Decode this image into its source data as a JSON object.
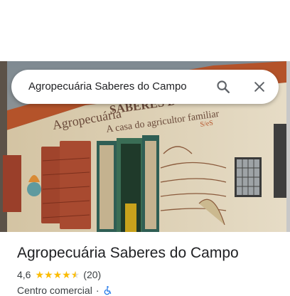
{
  "search": {
    "query": "Agropecuária Saberes do Campo"
  },
  "photo": {
    "sign_main": "Agropecuária",
    "sign_secondary": "SABERES D",
    "sign_tagline": "A casa do agricultor familiar",
    "sign_small": "S/eS"
  },
  "place": {
    "name": "Agropecuária Saberes do Campo",
    "rating": "4,6",
    "stars": 4.6,
    "review_count": "(20)",
    "category": "Centro comercial",
    "separator": "·"
  },
  "icons": [
    "search-icon",
    "close-icon",
    "star-icon",
    "wheelchair-accessible-icon"
  ],
  "colors": {
    "star": "#fbbc04",
    "accessible": "#1a73e8",
    "text": "#202124"
  }
}
